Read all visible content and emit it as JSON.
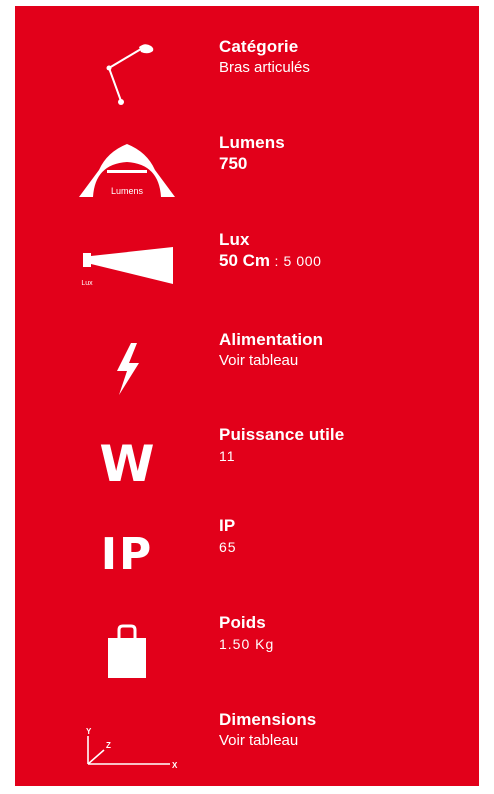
{
  "colors": {
    "panel": "#e2001a",
    "text": "#ffffff"
  },
  "specs": [
    {
      "icon": "articulated-arm-icon",
      "label": "Catégorie",
      "value": "Bras articulés"
    },
    {
      "icon": "lumens-dome-icon",
      "icon_caption": "Lumens",
      "label": "Lumens",
      "value": "750"
    },
    {
      "icon": "lux-beam-icon",
      "icon_caption": "Lux",
      "label": "Lux",
      "value_bold": "50 Cm",
      "value_rest": " : 5 000"
    },
    {
      "icon": "lightning-bolt-icon",
      "label": "Alimentation",
      "value": "Voir tableau"
    },
    {
      "icon": "watt-icon",
      "icon_glyph": "W",
      "label": "Puissance utile",
      "value": "11"
    },
    {
      "icon": "ip-rating-icon",
      "icon_glyph": "IP",
      "label": "IP",
      "value": "65"
    },
    {
      "icon": "weight-bag-icon",
      "label": "Poids",
      "value": "1.50 Kg"
    },
    {
      "icon": "dimensions-axes-icon",
      "axis_labels": [
        "Y",
        "Z",
        "X"
      ],
      "label": "Dimensions",
      "value": "Voir tableau"
    }
  ]
}
